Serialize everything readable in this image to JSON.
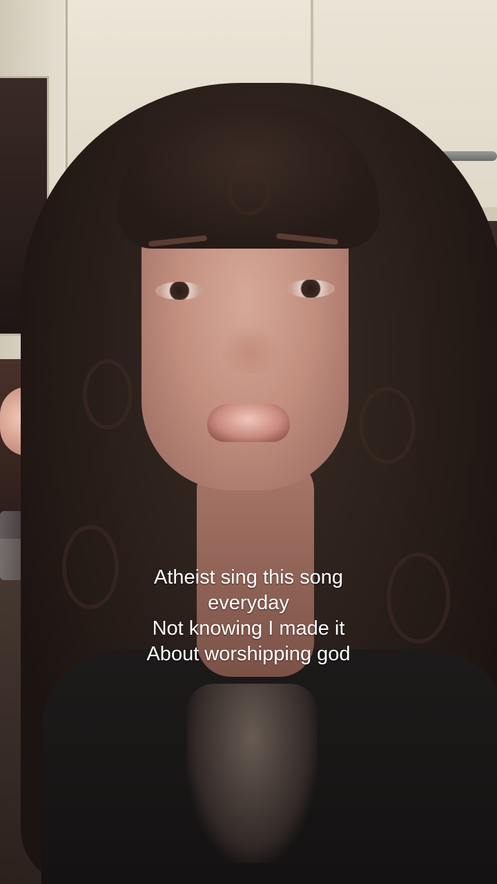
{
  "caption": {
    "lines": [
      "Atheist sing this song",
      "everyday",
      "Not knowing I made it",
      "About worshipping god"
    ]
  },
  "scene": {
    "description_icons": [
      "person-photo",
      "kitchen-background"
    ]
  }
}
